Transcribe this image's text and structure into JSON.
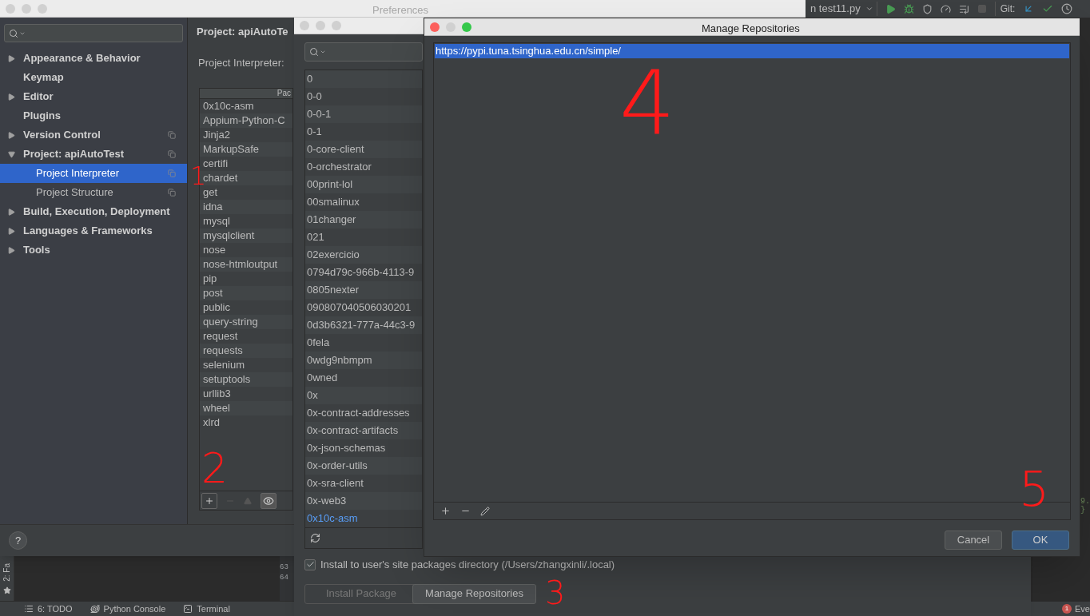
{
  "ide": {
    "run_config": "n test11.py",
    "git_label": "Git:",
    "side_tab": "2: Fa",
    "line_numbers": [
      "63",
      "64"
    ],
    "code_fragments": [
      "9.",
      "}"
    ],
    "status_bar": [
      {
        "kind": "todo",
        "label": "6: TODO"
      },
      {
        "kind": "console",
        "label": "Python Console"
      },
      {
        "kind": "terminal",
        "label": "Terminal"
      }
    ],
    "event_log": {
      "badge": "1",
      "label": "Eve"
    }
  },
  "preferences": {
    "title": "Preferences",
    "active": false,
    "tree": [
      {
        "label": "Appearance & Behavior",
        "expandable": true,
        "expanded": false,
        "project_scoped": false,
        "selected": false
      },
      {
        "label": "Keymap",
        "expandable": false,
        "project_scoped": false,
        "selected": false
      },
      {
        "label": "Editor",
        "expandable": true,
        "expanded": false,
        "project_scoped": false,
        "selected": false
      },
      {
        "label": "Plugins",
        "expandable": false,
        "project_scoped": false,
        "selected": false
      },
      {
        "label": "Version Control",
        "expandable": true,
        "expanded": false,
        "project_scoped": true,
        "selected": false
      },
      {
        "label": "Project: apiAutoTest",
        "expandable": true,
        "expanded": true,
        "project_scoped": true,
        "selected": false,
        "children": [
          {
            "label": "Project Interpreter",
            "expandable": false,
            "project_scoped": true,
            "selected": true
          },
          {
            "label": "Project Structure",
            "expandable": false,
            "project_scoped": true,
            "selected": false
          }
        ]
      },
      {
        "label": "Build, Execution, Deployment",
        "expandable": true,
        "expanded": false,
        "project_scoped": false,
        "selected": false
      },
      {
        "label": "Languages & Frameworks",
        "expandable": true,
        "expanded": false,
        "project_scoped": false,
        "selected": false
      },
      {
        "label": "Tools",
        "expandable": true,
        "expanded": false,
        "project_scoped": false,
        "selected": false
      }
    ],
    "heading": "Project: apiAutoTe",
    "help_label": "?",
    "interpreter_label": "Project Interpreter:",
    "table": {
      "columns": [
        "Pac"
      ],
      "rows": [
        "0x10c-asm",
        "Appium-Python-C",
        "Jinja2",
        "MarkupSafe",
        "certifi",
        "chardet",
        "get",
        "idna",
        "mysql",
        "mysqlclient",
        "nose",
        "nose-htmloutput",
        "pip",
        "post",
        "public",
        "query-string",
        "request",
        "requests",
        "selenium",
        "setuptools",
        "urllib3",
        "wheel",
        "xlrd"
      ]
    }
  },
  "available_packages": {
    "active": false,
    "packages": [
      {
        "name": "0",
        "selected": false
      },
      {
        "name": "0-0",
        "selected": false
      },
      {
        "name": "0-0-1",
        "selected": false
      },
      {
        "name": "0-1",
        "selected": false
      },
      {
        "name": "0-core-client",
        "selected": false
      },
      {
        "name": "0-orchestrator",
        "selected": false
      },
      {
        "name": "00print-lol",
        "selected": false
      },
      {
        "name": "00smalinux",
        "selected": false
      },
      {
        "name": "01changer",
        "selected": false
      },
      {
        "name": "021",
        "selected": false
      },
      {
        "name": "02exercicio",
        "selected": false
      },
      {
        "name": "0794d79c-966b-4113-9",
        "selected": false
      },
      {
        "name": "0805nexter",
        "selected": false
      },
      {
        "name": "090807040506030201",
        "selected": false
      },
      {
        "name": "0d3b6321-777a-44c3-9",
        "selected": false
      },
      {
        "name": "0fela",
        "selected": false
      },
      {
        "name": "0wdg9nbmpm",
        "selected": false
      },
      {
        "name": "0wned",
        "selected": false
      },
      {
        "name": "0x",
        "selected": false
      },
      {
        "name": "0x-contract-addresses",
        "selected": false
      },
      {
        "name": "0x-contract-artifacts",
        "selected": false
      },
      {
        "name": "0x-json-schemas",
        "selected": false
      },
      {
        "name": "0x-order-utils",
        "selected": false
      },
      {
        "name": "0x-sra-client",
        "selected": false
      },
      {
        "name": "0x-web3",
        "selected": false
      },
      {
        "name": "0x10c-asm",
        "selected": true
      }
    ],
    "install_option": {
      "label": "Install to user's site packages directory (/Users/zhangxinli/.local)",
      "checked": true
    },
    "buttons": [
      {
        "label": "Install Package",
        "disabled": true
      },
      {
        "label": "Manage Repositories",
        "disabled": false
      }
    ]
  },
  "manage_repositories": {
    "title": "Manage Repositories",
    "active": true,
    "repositories": [
      {
        "url": "https://pypi.tuna.tsinghua.edu.cn/simple/",
        "selected": true
      }
    ],
    "buttons": [
      {
        "label": "Cancel",
        "default": false
      },
      {
        "label": "OK",
        "default": true
      }
    ]
  },
  "annotations": [
    "1",
    "2",
    "3",
    "4",
    "5"
  ]
}
